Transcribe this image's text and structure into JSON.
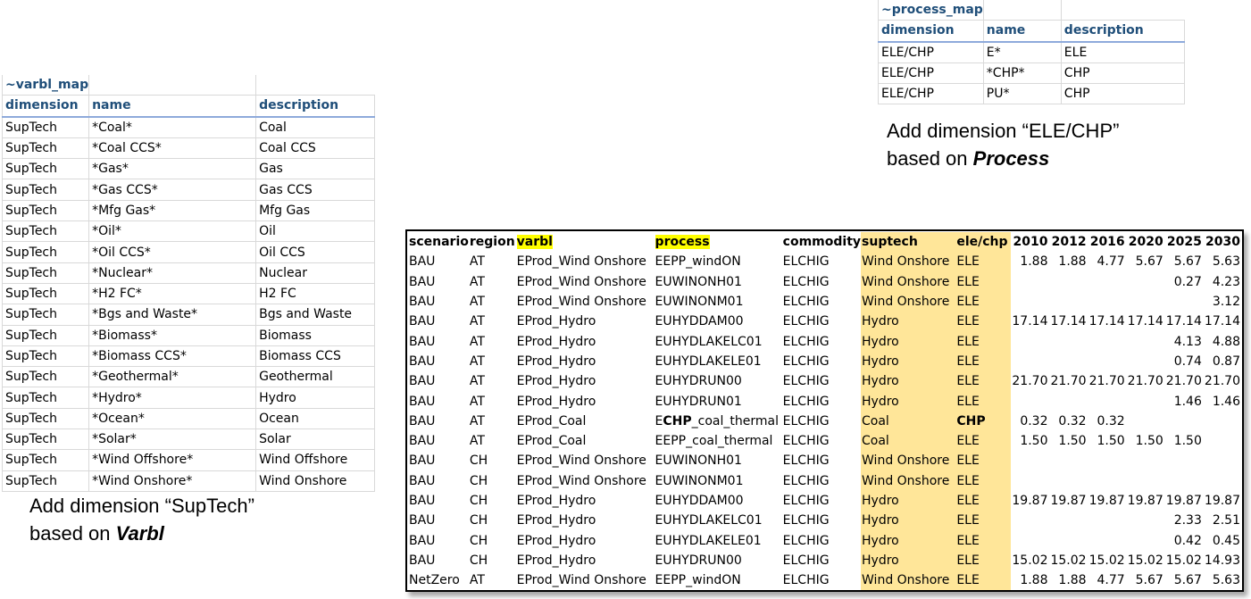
{
  "varbl_map": {
    "title": "~varbl_map",
    "headers": [
      "dimension",
      "name",
      "description"
    ],
    "rows": [
      [
        "SupTech",
        "*Coal*",
        "Coal"
      ],
      [
        "SupTech",
        "*Coal CCS*",
        "Coal CCS"
      ],
      [
        "SupTech",
        "*Gas*",
        "Gas"
      ],
      [
        "SupTech",
        "*Gas CCS*",
        "Gas CCS"
      ],
      [
        "SupTech",
        "*Mfg Gas*",
        "Mfg Gas"
      ],
      [
        "SupTech",
        "*Oil*",
        "Oil"
      ],
      [
        "SupTech",
        "*Oil CCS*",
        "Oil CCS"
      ],
      [
        "SupTech",
        "*Nuclear*",
        "Nuclear"
      ],
      [
        "SupTech",
        "*H2 FC*",
        "H2 FC"
      ],
      [
        "SupTech",
        "*Bgs and Waste*",
        "Bgs and Waste"
      ],
      [
        "SupTech",
        "*Biomass*",
        "Biomass"
      ],
      [
        "SupTech",
        "*Biomass CCS*",
        "Biomass CCS"
      ],
      [
        "SupTech",
        "*Geothermal*",
        "Geothermal"
      ],
      [
        "SupTech",
        "*Hydro*",
        "Hydro"
      ],
      [
        "SupTech",
        "*Ocean*",
        "Ocean"
      ],
      [
        "SupTech",
        "*Solar*",
        "Solar"
      ],
      [
        "SupTech",
        "*Wind Offshore*",
        "Wind Offshore"
      ],
      [
        "SupTech",
        "*Wind Onshore*",
        "Wind Onshore"
      ]
    ]
  },
  "process_map": {
    "title": "~process_map",
    "headers": [
      "dimension",
      "name",
      "description"
    ],
    "rows": [
      [
        "ELE/CHP",
        "E*",
        "ELE"
      ],
      [
        "ELE/CHP",
        "*CHP*",
        "CHP"
      ],
      [
        "ELE/CHP",
        "PU*",
        "CHP"
      ]
    ]
  },
  "notes": {
    "process": {
      "line1": "Add dimension “ELE/CHP”",
      "line2_prefix": "based on ",
      "line2_em": "Process"
    },
    "varbl": {
      "line1": "Add dimension “SupTech”",
      "line2_prefix": "based on ",
      "line2_em": "Varbl"
    }
  },
  "main_table": {
    "headers": [
      "scenario",
      "region",
      "varbl",
      "process",
      "commodity",
      "suptech",
      "ele/chp",
      "2010",
      "2012",
      "2016",
      "2020",
      "2025",
      "2030"
    ],
    "highlight_colors": {
      "header_yellow": "#ffff00",
      "column_orange": "#ffe699"
    },
    "rows": [
      {
        "scenario": "BAU",
        "region": "AT",
        "varbl": "EProd_Wind Onshore",
        "process_pre": "",
        "process_bold": "",
        "process_post": "EEPP_windON",
        "commodity": "ELCHIG",
        "suptech": "Wind Onshore",
        "elechp": "ELE",
        "elechp_bold": false,
        "values": [
          "1.88",
          "1.88",
          "4.77",
          "5.67",
          "5.67",
          "5.63"
        ]
      },
      {
        "scenario": "BAU",
        "region": "AT",
        "varbl": "EProd_Wind Onshore",
        "process_pre": "",
        "process_bold": "",
        "process_post": "EUWINONH01",
        "commodity": "ELCHIG",
        "suptech": "Wind Onshore",
        "elechp": "ELE",
        "elechp_bold": false,
        "values": [
          "",
          "",
          "",
          "",
          "0.27",
          "4.23"
        ]
      },
      {
        "scenario": "BAU",
        "region": "AT",
        "varbl": "EProd_Wind Onshore",
        "process_pre": "",
        "process_bold": "",
        "process_post": "EUWINONM01",
        "commodity": "ELCHIG",
        "suptech": "Wind Onshore",
        "elechp": "ELE",
        "elechp_bold": false,
        "values": [
          "",
          "",
          "",
          "",
          "",
          "3.12"
        ]
      },
      {
        "scenario": "BAU",
        "region": "AT",
        "varbl": "EProd_Hydro",
        "process_pre": "",
        "process_bold": "",
        "process_post": "EUHYDDAM00",
        "commodity": "ELCHIG",
        "suptech": "Hydro",
        "elechp": "ELE",
        "elechp_bold": false,
        "values": [
          "17.14",
          "17.14",
          "17.14",
          "17.14",
          "17.14",
          "17.14"
        ]
      },
      {
        "scenario": "BAU",
        "region": "AT",
        "varbl": "EProd_Hydro",
        "process_pre": "",
        "process_bold": "",
        "process_post": "EUHYDLAKELC01",
        "commodity": "ELCHIG",
        "suptech": "Hydro",
        "elechp": "ELE",
        "elechp_bold": false,
        "values": [
          "",
          "",
          "",
          "",
          "4.13",
          "4.88"
        ]
      },
      {
        "scenario": "BAU",
        "region": "AT",
        "varbl": "EProd_Hydro",
        "process_pre": "",
        "process_bold": "",
        "process_post": "EUHYDLAKELE01",
        "commodity": "ELCHIG",
        "suptech": "Hydro",
        "elechp": "ELE",
        "elechp_bold": false,
        "values": [
          "",
          "",
          "",
          "",
          "0.74",
          "0.87"
        ]
      },
      {
        "scenario": "BAU",
        "region": "AT",
        "varbl": "EProd_Hydro",
        "process_pre": "",
        "process_bold": "",
        "process_post": "EUHYDRUN00",
        "commodity": "ELCHIG",
        "suptech": "Hydro",
        "elechp": "ELE",
        "elechp_bold": false,
        "values": [
          "21.70",
          "21.70",
          "21.70",
          "21.70",
          "21.70",
          "21.70"
        ]
      },
      {
        "scenario": "BAU",
        "region": "AT",
        "varbl": "EProd_Hydro",
        "process_pre": "",
        "process_bold": "",
        "process_post": "EUHYDRUN01",
        "commodity": "ELCHIG",
        "suptech": "Hydro",
        "elechp": "ELE",
        "elechp_bold": false,
        "values": [
          "",
          "",
          "",
          "",
          "1.46",
          "1.46"
        ]
      },
      {
        "scenario": "BAU",
        "region": "AT",
        "varbl": "EProd_Coal",
        "process_pre": "E",
        "process_bold": "CHP",
        "process_post": "_coal_thermal",
        "commodity": "ELCHIG",
        "suptech": "Coal",
        "elechp": "CHP",
        "elechp_bold": true,
        "values": [
          "0.32",
          "0.32",
          "0.32",
          "",
          "",
          ""
        ]
      },
      {
        "scenario": "BAU",
        "region": "AT",
        "varbl": "EProd_Coal",
        "process_pre": "",
        "process_bold": "",
        "process_post": "EEPP_coal_thermal",
        "commodity": "ELCHIG",
        "suptech": "Coal",
        "elechp": "ELE",
        "elechp_bold": false,
        "values": [
          "1.50",
          "1.50",
          "1.50",
          "1.50",
          "1.50",
          ""
        ]
      },
      {
        "scenario": "BAU",
        "region": "CH",
        "varbl": "EProd_Wind Onshore",
        "process_pre": "",
        "process_bold": "",
        "process_post": "EUWINONH01",
        "commodity": "ELCHIG",
        "suptech": "Wind Onshore",
        "elechp": "ELE",
        "elechp_bold": false,
        "values": [
          "",
          "",
          "",
          "",
          "",
          ""
        ]
      },
      {
        "scenario": "BAU",
        "region": "CH",
        "varbl": "EProd_Wind Onshore",
        "process_pre": "",
        "process_bold": "",
        "process_post": "EUWINONM01",
        "commodity": "ELCHIG",
        "suptech": "Wind Onshore",
        "elechp": "ELE",
        "elechp_bold": false,
        "values": [
          "",
          "",
          "",
          "",
          "",
          ""
        ]
      },
      {
        "scenario": "BAU",
        "region": "CH",
        "varbl": "EProd_Hydro",
        "process_pre": "",
        "process_bold": "",
        "process_post": "EUHYDDAM00",
        "commodity": "ELCHIG",
        "suptech": "Hydro",
        "elechp": "ELE",
        "elechp_bold": false,
        "values": [
          "19.87",
          "19.87",
          "19.87",
          "19.87",
          "19.87",
          "19.87"
        ]
      },
      {
        "scenario": "BAU",
        "region": "CH",
        "varbl": "EProd_Hydro",
        "process_pre": "",
        "process_bold": "",
        "process_post": "EUHYDLAKELC01",
        "commodity": "ELCHIG",
        "suptech": "Hydro",
        "elechp": "ELE",
        "elechp_bold": false,
        "values": [
          "",
          "",
          "",
          "",
          "2.33",
          "2.51"
        ]
      },
      {
        "scenario": "BAU",
        "region": "CH",
        "varbl": "EProd_Hydro",
        "process_pre": "",
        "process_bold": "",
        "process_post": "EUHYDLAKELE01",
        "commodity": "ELCHIG",
        "suptech": "Hydro",
        "elechp": "ELE",
        "elechp_bold": false,
        "values": [
          "",
          "",
          "",
          "",
          "0.42",
          "0.45"
        ]
      },
      {
        "scenario": "BAU",
        "region": "CH",
        "varbl": "EProd_Hydro",
        "process_pre": "",
        "process_bold": "",
        "process_post": "EUHYDRUN00",
        "commodity": "ELCHIG",
        "suptech": "Hydro",
        "elechp": "ELE",
        "elechp_bold": false,
        "values": [
          "15.02",
          "15.02",
          "15.02",
          "15.02",
          "15.02",
          "14.93"
        ]
      },
      {
        "scenario": "NetZero",
        "region": "AT",
        "varbl": "EProd_Wind Onshore",
        "process_pre": "",
        "process_bold": "",
        "process_post": "EEPP_windON",
        "commodity": "ELCHIG",
        "suptech": "Wind Onshore",
        "elechp": "ELE",
        "elechp_bold": false,
        "values": [
          "1.88",
          "1.88",
          "4.77",
          "5.67",
          "5.67",
          "5.63"
        ]
      }
    ]
  }
}
